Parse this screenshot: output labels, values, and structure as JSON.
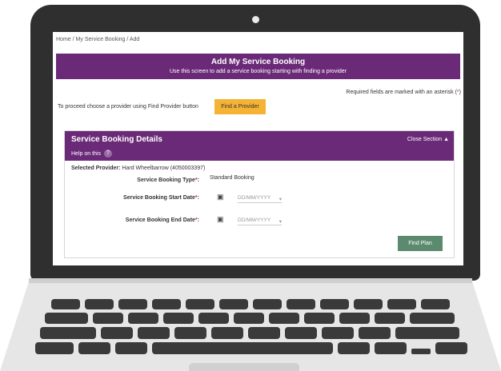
{
  "breadcrumb": {
    "home": "Home",
    "sep": "/",
    "service": "My Service Booking",
    "current": "Add"
  },
  "header": {
    "title": "Add My Service Booking",
    "subtitle": "Use this screen to add a service booking starting with finding a provider"
  },
  "notice": {
    "required_text": "Required fields are marked with an asterisk (",
    "required_star": "*",
    "required_end": ")"
  },
  "proceed": {
    "text": "To proceed choose a provider using Find Provider button",
    "button": "Find a Provider"
  },
  "section": {
    "title": "Service Booking Details",
    "help": "Help on this",
    "help_icon": "?",
    "close": "Close Section",
    "close_icon": "▲",
    "selected_label": "Selected Provider:",
    "selected_value": "Hard Wheelbarrow (4050003397)",
    "type_label": "Service Booking Type",
    "type_value": "Standard Booking",
    "start_label": "Service Booking Start Date",
    "end_label": "Service Booking End Date",
    "asterisk": "*",
    "colon": ":",
    "date_placeholder": "DD/MM/YYYY",
    "find_plan": "Find Plan"
  },
  "colors": {
    "purple": "#6b2a78",
    "amber": "#f5b335",
    "green": "#5b8a6e"
  }
}
